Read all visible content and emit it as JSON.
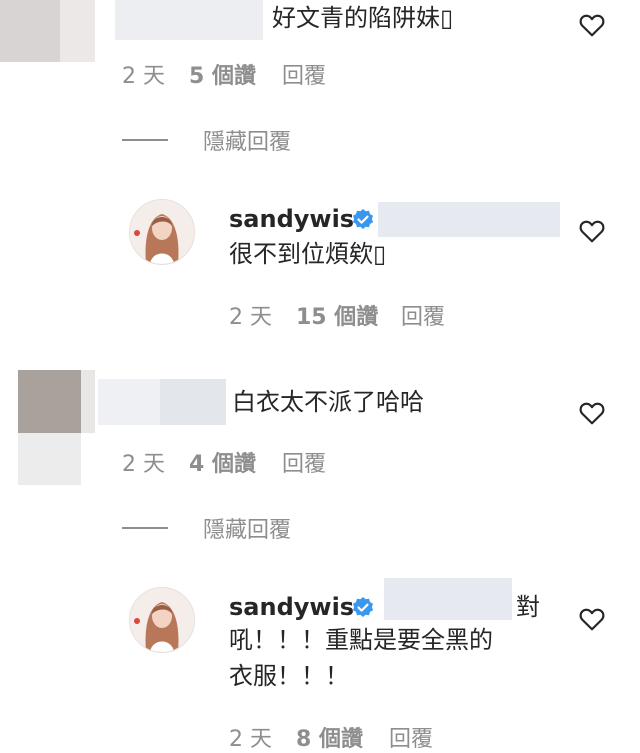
{
  "comments": [
    {
      "text": "好文青的陷阱妹▯",
      "meta": {
        "time": "2 天",
        "likes": "5 個讚",
        "reply": "回覆"
      }
    },
    {
      "username": "sandywis",
      "text": "很不到位煩欸▯",
      "meta": {
        "time": "2 天",
        "likes": "15 個讚",
        "reply": "回覆"
      }
    },
    {
      "text": "白衣太不派了哈哈",
      "meta": {
        "time": "2 天",
        "likes": "4 個讚",
        "reply": "回覆"
      }
    },
    {
      "username": "sandywis",
      "text_inline": "對",
      "text_line2": "吼！！！重點是要全黑的",
      "text_line3": "衣服！！！",
      "meta": {
        "time": "2 天",
        "likes": "8 個讚",
        "reply": "回覆"
      }
    }
  ],
  "hide_replies": "隱藏回覆",
  "icons": {
    "like": "heart-outline-icon",
    "verified": "verified-badge-icon",
    "avatar": "profile-avatar"
  },
  "colors": {
    "text": "#262626",
    "meta": "#8e8e8e",
    "verified": "#3897f0",
    "redacted": "#e6e9ef"
  }
}
